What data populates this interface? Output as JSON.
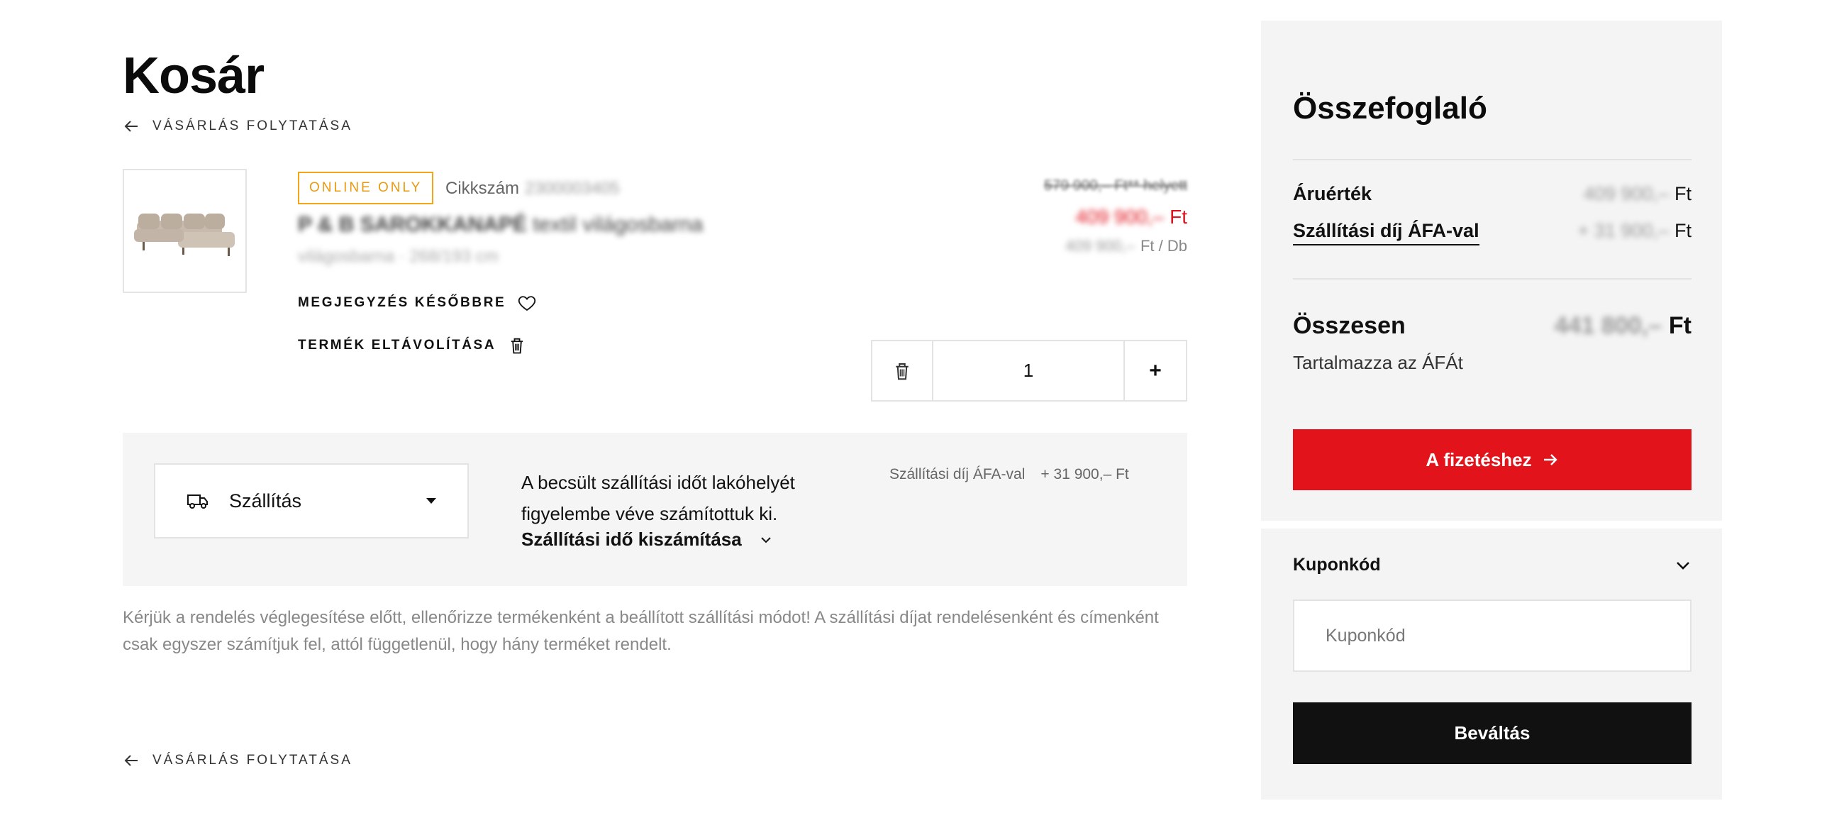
{
  "cart": {
    "title": "Kosár",
    "continue_label": "Vásárlás folytatása"
  },
  "product": {
    "badge": "ONLINE ONLY",
    "sku_label": "Cikkszám",
    "sku_value": "2300003405",
    "name": "P & B SAROKKANAPÉ",
    "name_sub": "textil világosbarna",
    "attrs": "világosbarna  ·  268/193 cm",
    "price_old": "579 900,– Ft** helyett",
    "price_new_value": "409 900,–",
    "price_new_currency": "Ft",
    "unit_price_value": "409 900,–",
    "unit_price_suffix": "Ft / Db",
    "save_later": "Megjegyzés későbbre",
    "remove": "Termék eltávolítása",
    "quantity": "1",
    "plus": "+"
  },
  "shipping": {
    "select_label": "Szállítás",
    "info": "A becsült szállítási időt lakóhelyét figyelembe véve számítottuk ki.",
    "calc_link": "Szállítási idő kiszámítása",
    "fee_label": "Szállítási díj ÁFA-val",
    "fee_value": "+ 31 900,– Ft"
  },
  "notice": "Kérjük a rendelés véglegesítése előtt, ellenőrizze termékenként a beállított szállítási módot! A szállítási díjat rendelésenként és címenként csak egyszer számítjuk fel, attól függetlenül, hogy hány terméket rendelt.",
  "summary": {
    "title": "Összefoglaló",
    "goods_label": "Áruérték",
    "goods_value": "409 900,–",
    "goods_currency": "Ft",
    "shipping_label": "Szállítási díj ÁFA-val",
    "shipping_value": "+ 31 900,–",
    "shipping_currency": "Ft",
    "total_label": "Összesen",
    "total_value": "441 800,–",
    "total_currency": "Ft",
    "vat_note": "Tartalmazza az ÁFÁt",
    "checkout": "A fizetéshez"
  },
  "coupon": {
    "title": "Kuponkód",
    "placeholder": "Kuponkód",
    "redeem": "Beváltás"
  },
  "colors": {
    "accent_red": "#e3131b",
    "badge_orange": "#f2a51a",
    "panel_gray": "#f4f4f4",
    "button_black": "#111111"
  }
}
